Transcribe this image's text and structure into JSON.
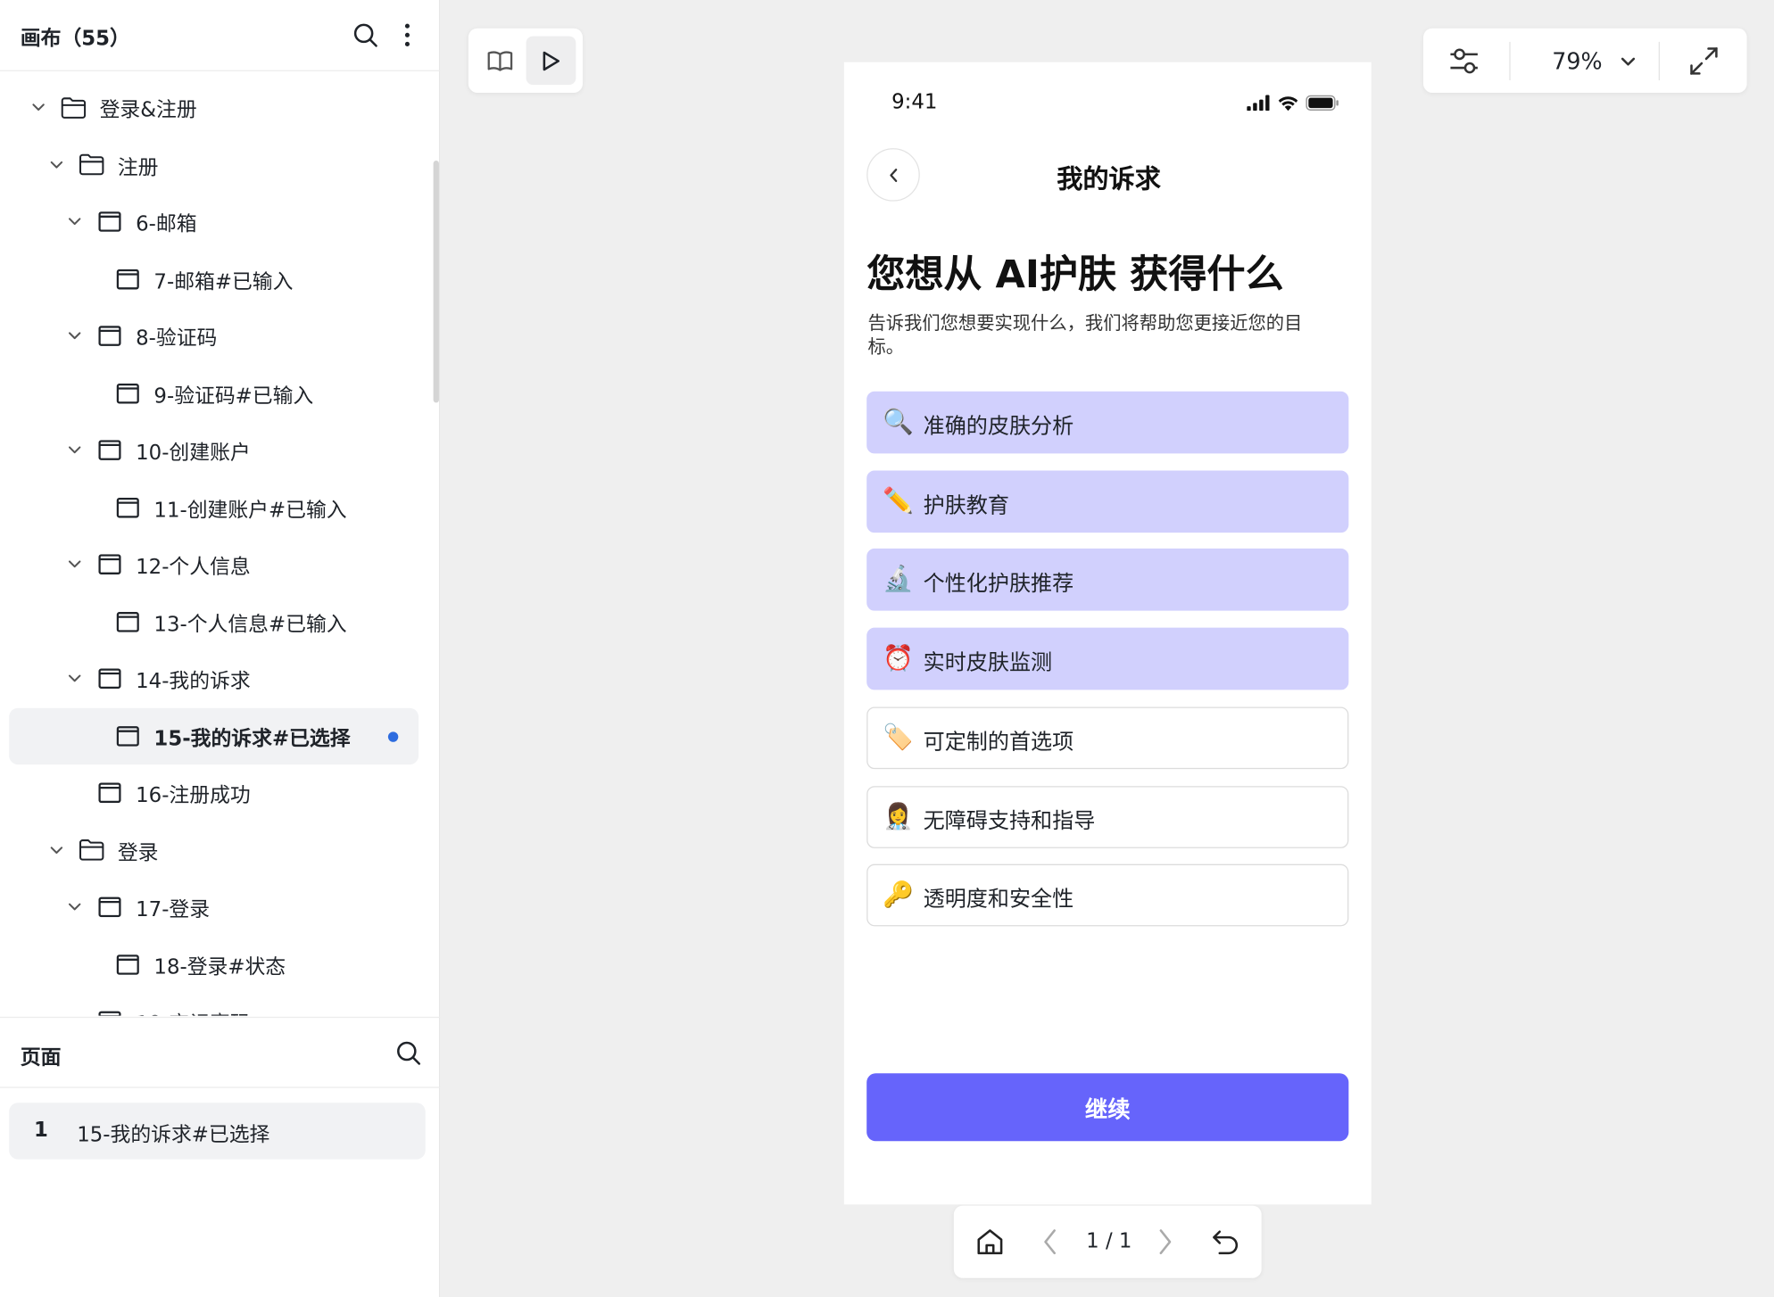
{
  "canvas_panel": {
    "title": "画布（55）",
    "tree": [
      {
        "label": "登录&注册",
        "type": "folder",
        "level": 0,
        "expanded": true
      },
      {
        "label": "注册",
        "type": "folder",
        "level": 1,
        "expanded": true
      },
      {
        "label": "6-邮箱",
        "type": "frame",
        "level": 2,
        "expanded": true
      },
      {
        "label": "7-邮箱#已输入",
        "type": "frame",
        "level": 3
      },
      {
        "label": "8-验证码",
        "type": "frame",
        "level": 2,
        "expanded": true
      },
      {
        "label": "9-验证码#已输入",
        "type": "frame",
        "level": 3
      },
      {
        "label": "10-创建账户",
        "type": "frame",
        "level": 2,
        "expanded": true
      },
      {
        "label": "11-创建账户#已输入",
        "type": "frame",
        "level": 3
      },
      {
        "label": "12-个人信息",
        "type": "frame",
        "level": 2,
        "expanded": true
      },
      {
        "label": "13-个人信息#已输入",
        "type": "frame",
        "level": 3
      },
      {
        "label": "14-我的诉求",
        "type": "frame",
        "level": 2,
        "expanded": true
      },
      {
        "label": "15-我的诉求#已选择",
        "type": "frame",
        "level": 3,
        "selected": true
      },
      {
        "label": "16-注册成功",
        "type": "frame",
        "level": 2
      },
      {
        "label": "登录",
        "type": "folder",
        "level": 1,
        "expanded": true
      },
      {
        "label": "17-登录",
        "type": "frame",
        "level": 2,
        "expanded": true
      },
      {
        "label": "18-登录#状态",
        "type": "frame",
        "level": 3
      },
      {
        "label": "19-忘记密码",
        "type": "frame",
        "level": 2,
        "expanded": true
      }
    ]
  },
  "pages_panel": {
    "title": "页面",
    "pages": [
      {
        "number": "1",
        "label": "15-我的诉求#已选择"
      }
    ]
  },
  "view_toolbar": {
    "zoom": "79%"
  },
  "pager": {
    "text": "1 / 1"
  },
  "phone": {
    "status_time": "9:41",
    "nav_title": "我的诉求",
    "heading": "您想从 AI护肤 获得什么",
    "subtext": "告诉我们您想要实现什么，我们将帮助您更接近您的目标。",
    "options": [
      {
        "emoji": "🔍",
        "label": "准确的皮肤分析",
        "selected": true
      },
      {
        "emoji": "✏️",
        "label": "护肤教育",
        "selected": true
      },
      {
        "emoji": "🔬",
        "label": "个性化护肤推荐",
        "selected": true
      },
      {
        "emoji": "⏰",
        "label": "实时皮肤监测",
        "selected": true
      },
      {
        "emoji": "🏷️",
        "label": "可定制的首选项",
        "selected": false
      },
      {
        "emoji": "👩‍⚕️",
        "label": "无障碍支持和指导",
        "selected": false
      },
      {
        "emoji": "🔑",
        "label": "透明度和安全性",
        "selected": false
      }
    ],
    "continue_label": "继续"
  },
  "colors": {
    "accent": "#6664fb",
    "selected_option": "#d1d0fd",
    "selected_dot": "#2d6cdf"
  }
}
